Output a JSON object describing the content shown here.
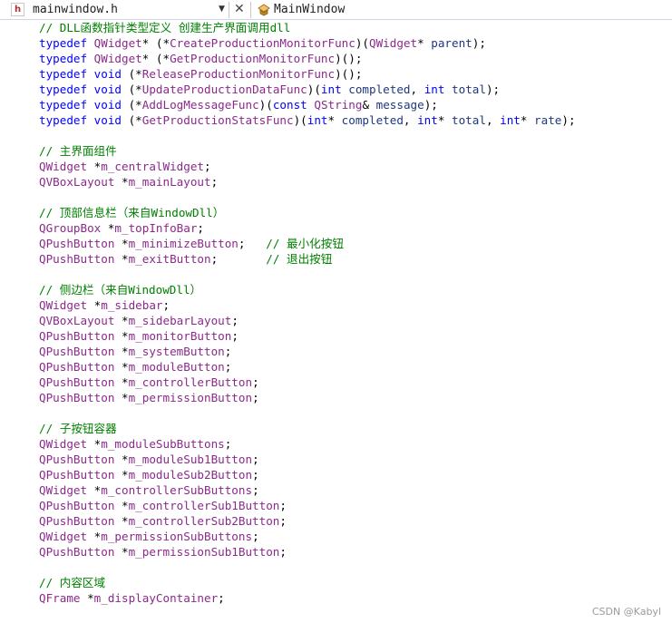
{
  "tab": {
    "file_name": "mainwindow.h",
    "file_icon_letter": "h",
    "class_name": "MainWindow"
  },
  "watermark": "CSDN @Kabyl",
  "lines": [
    [
      {
        "c": "comment",
        "t": "// DLL函数指针类型定义 创建生产界面调用dll"
      }
    ],
    [
      {
        "c": "kw",
        "t": "typedef "
      },
      {
        "c": "type",
        "t": "QWidget"
      },
      {
        "c": "txt",
        "t": "* (*"
      },
      {
        "c": "fn",
        "t": "CreateProductionMonitorFunc"
      },
      {
        "c": "txt",
        "t": ")("
      },
      {
        "c": "type",
        "t": "QWidget"
      },
      {
        "c": "txt",
        "t": "* "
      },
      {
        "c": "param",
        "t": "parent"
      },
      {
        "c": "txt",
        "t": ");"
      }
    ],
    [
      {
        "c": "kw",
        "t": "typedef "
      },
      {
        "c": "type",
        "t": "QWidget"
      },
      {
        "c": "txt",
        "t": "* (*"
      },
      {
        "c": "fn",
        "t": "GetProductionMonitorFunc"
      },
      {
        "c": "txt",
        "t": ")();"
      }
    ],
    [
      {
        "c": "kw",
        "t": "typedef "
      },
      {
        "c": "kw",
        "t": "void"
      },
      {
        "c": "txt",
        "t": " (*"
      },
      {
        "c": "fn",
        "t": "ReleaseProductionMonitorFunc"
      },
      {
        "c": "txt",
        "t": ")();"
      }
    ],
    [
      {
        "c": "kw",
        "t": "typedef "
      },
      {
        "c": "kw",
        "t": "void"
      },
      {
        "c": "txt",
        "t": " (*"
      },
      {
        "c": "fn",
        "t": "UpdateProductionDataFunc"
      },
      {
        "c": "txt",
        "t": ")("
      },
      {
        "c": "kw",
        "t": "int"
      },
      {
        "c": "txt",
        "t": " "
      },
      {
        "c": "param",
        "t": "completed"
      },
      {
        "c": "txt",
        "t": ", "
      },
      {
        "c": "kw",
        "t": "int"
      },
      {
        "c": "txt",
        "t": " "
      },
      {
        "c": "param",
        "t": "total"
      },
      {
        "c": "txt",
        "t": ");"
      }
    ],
    [
      {
        "c": "kw",
        "t": "typedef "
      },
      {
        "c": "kw",
        "t": "void"
      },
      {
        "c": "txt",
        "t": " (*"
      },
      {
        "c": "fn",
        "t": "AddLogMessageFunc"
      },
      {
        "c": "txt",
        "t": ")("
      },
      {
        "c": "kw",
        "t": "const"
      },
      {
        "c": "txt",
        "t": " "
      },
      {
        "c": "type",
        "t": "QString"
      },
      {
        "c": "txt",
        "t": "& "
      },
      {
        "c": "param",
        "t": "message"
      },
      {
        "c": "txt",
        "t": ");"
      }
    ],
    [
      {
        "c": "kw",
        "t": "typedef "
      },
      {
        "c": "kw",
        "t": "void"
      },
      {
        "c": "txt",
        "t": " (*"
      },
      {
        "c": "fn",
        "t": "GetProductionStatsFunc"
      },
      {
        "c": "txt",
        "t": ")("
      },
      {
        "c": "kw",
        "t": "int"
      },
      {
        "c": "txt",
        "t": "* "
      },
      {
        "c": "param",
        "t": "completed"
      },
      {
        "c": "txt",
        "t": ", "
      },
      {
        "c": "kw",
        "t": "int"
      },
      {
        "c": "txt",
        "t": "* "
      },
      {
        "c": "param",
        "t": "total"
      },
      {
        "c": "txt",
        "t": ", "
      },
      {
        "c": "kw",
        "t": "int"
      },
      {
        "c": "txt",
        "t": "* "
      },
      {
        "c": "param",
        "t": "rate"
      },
      {
        "c": "txt",
        "t": ");"
      }
    ],
    [],
    [
      {
        "c": "comment",
        "t": "// 主界面组件"
      }
    ],
    [
      {
        "c": "type",
        "t": "QWidget"
      },
      {
        "c": "txt",
        "t": " *"
      },
      {
        "c": "fn",
        "t": "m_centralWidget"
      },
      {
        "c": "txt",
        "t": ";"
      }
    ],
    [
      {
        "c": "type",
        "t": "QVBoxLayout"
      },
      {
        "c": "txt",
        "t": " *"
      },
      {
        "c": "fn",
        "t": "m_mainLayout"
      },
      {
        "c": "txt",
        "t": ";"
      }
    ],
    [],
    [
      {
        "c": "comment",
        "t": "// 顶部信息栏（来自WindowDll）"
      }
    ],
    [
      {
        "c": "type",
        "t": "QGroupBox"
      },
      {
        "c": "txt",
        "t": " *"
      },
      {
        "c": "fn",
        "t": "m_topInfoBar"
      },
      {
        "c": "txt",
        "t": ";"
      }
    ],
    [
      {
        "c": "type",
        "t": "QPushButton"
      },
      {
        "c": "txt",
        "t": " *"
      },
      {
        "c": "fn",
        "t": "m_minimizeButton"
      },
      {
        "c": "txt",
        "t": ";   "
      },
      {
        "c": "comment",
        "t": "// 最小化按钮"
      }
    ],
    [
      {
        "c": "type",
        "t": "QPushButton"
      },
      {
        "c": "txt",
        "t": " *"
      },
      {
        "c": "fn",
        "t": "m_exitButton"
      },
      {
        "c": "txt",
        "t": ";       "
      },
      {
        "c": "comment",
        "t": "// 退出按钮"
      }
    ],
    [],
    [
      {
        "c": "comment",
        "t": "// 侧边栏（来自WindowDll）"
      }
    ],
    [
      {
        "c": "type",
        "t": "QWidget"
      },
      {
        "c": "txt",
        "t": " *"
      },
      {
        "c": "fn",
        "t": "m_sidebar"
      },
      {
        "c": "txt",
        "t": ";"
      }
    ],
    [
      {
        "c": "type",
        "t": "QVBoxLayout"
      },
      {
        "c": "txt",
        "t": " *"
      },
      {
        "c": "fn",
        "t": "m_sidebarLayout"
      },
      {
        "c": "txt",
        "t": ";"
      }
    ],
    [
      {
        "c": "type",
        "t": "QPushButton"
      },
      {
        "c": "txt",
        "t": " *"
      },
      {
        "c": "fn",
        "t": "m_monitorButton"
      },
      {
        "c": "txt",
        "t": ";"
      }
    ],
    [
      {
        "c": "type",
        "t": "QPushButton"
      },
      {
        "c": "txt",
        "t": " *"
      },
      {
        "c": "fn",
        "t": "m_systemButton"
      },
      {
        "c": "txt",
        "t": ";"
      }
    ],
    [
      {
        "c": "type",
        "t": "QPushButton"
      },
      {
        "c": "txt",
        "t": " *"
      },
      {
        "c": "fn",
        "t": "m_moduleButton"
      },
      {
        "c": "txt",
        "t": ";"
      }
    ],
    [
      {
        "c": "type",
        "t": "QPushButton"
      },
      {
        "c": "txt",
        "t": " *"
      },
      {
        "c": "fn",
        "t": "m_controllerButton"
      },
      {
        "c": "txt",
        "t": ";"
      }
    ],
    [
      {
        "c": "type",
        "t": "QPushButton"
      },
      {
        "c": "txt",
        "t": " *"
      },
      {
        "c": "fn",
        "t": "m_permissionButton"
      },
      {
        "c": "txt",
        "t": ";"
      }
    ],
    [],
    [
      {
        "c": "comment",
        "t": "// 子按钮容器"
      }
    ],
    [
      {
        "c": "type",
        "t": "QWidget"
      },
      {
        "c": "txt",
        "t": " *"
      },
      {
        "c": "fn",
        "t": "m_moduleSubButtons"
      },
      {
        "c": "txt",
        "t": ";"
      }
    ],
    [
      {
        "c": "type",
        "t": "QPushButton"
      },
      {
        "c": "txt",
        "t": " *"
      },
      {
        "c": "fn",
        "t": "m_moduleSub1Button"
      },
      {
        "c": "txt",
        "t": ";"
      }
    ],
    [
      {
        "c": "type",
        "t": "QPushButton"
      },
      {
        "c": "txt",
        "t": " *"
      },
      {
        "c": "fn",
        "t": "m_moduleSub2Button"
      },
      {
        "c": "txt",
        "t": ";"
      }
    ],
    [
      {
        "c": "type",
        "t": "QWidget"
      },
      {
        "c": "txt",
        "t": " *"
      },
      {
        "c": "fn",
        "t": "m_controllerSubButtons"
      },
      {
        "c": "txt",
        "t": ";"
      }
    ],
    [
      {
        "c": "type",
        "t": "QPushButton"
      },
      {
        "c": "txt",
        "t": " *"
      },
      {
        "c": "fn",
        "t": "m_controllerSub1Button"
      },
      {
        "c": "txt",
        "t": ";"
      }
    ],
    [
      {
        "c": "type",
        "t": "QPushButton"
      },
      {
        "c": "txt",
        "t": " *"
      },
      {
        "c": "fn",
        "t": "m_controllerSub2Button"
      },
      {
        "c": "txt",
        "t": ";"
      }
    ],
    [
      {
        "c": "type",
        "t": "QWidget"
      },
      {
        "c": "txt",
        "t": " *"
      },
      {
        "c": "fn",
        "t": "m_permissionSubButtons"
      },
      {
        "c": "txt",
        "t": ";"
      }
    ],
    [
      {
        "c": "type",
        "t": "QPushButton"
      },
      {
        "c": "txt",
        "t": " *"
      },
      {
        "c": "fn",
        "t": "m_permissionSub1Button"
      },
      {
        "c": "txt",
        "t": ";"
      }
    ],
    [],
    [
      {
        "c": "comment",
        "t": "// 内容区域"
      }
    ],
    [
      {
        "c": "type",
        "t": "QFrame"
      },
      {
        "c": "txt",
        "t": " *"
      },
      {
        "c": "fn",
        "t": "m_displayContainer"
      },
      {
        "c": "txt",
        "t": ";"
      }
    ]
  ]
}
